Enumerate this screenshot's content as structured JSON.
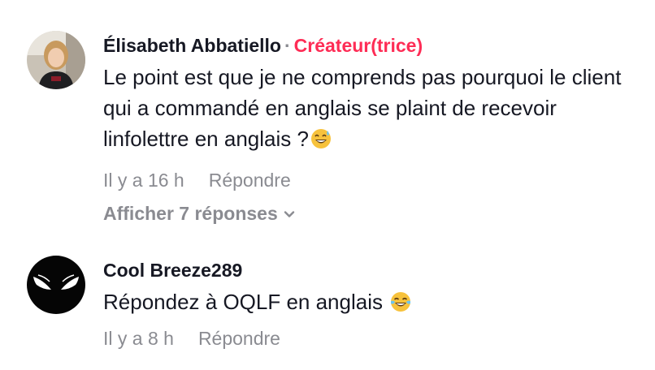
{
  "comments": [
    {
      "author": "Élisabeth Abbatiello",
      "separator": "·",
      "badge": "Créateur(trice)",
      "text": "Le point est que je ne comprends pas pourquoi le client qui a commandé en anglais se plaint de recevoir linfolettre en anglais ?",
      "emoji": "grinning-sweat-emoji",
      "time": "Il y a 16 h",
      "reply_label": "Répondre",
      "view_replies": "Afficher 7 réponses"
    },
    {
      "author": "Cool Breeze289",
      "text": "Répondez à OQLF en anglais",
      "emoji": "tears-of-joy-emoji",
      "time": "Il y a 8 h",
      "reply_label": "Répondre"
    }
  ],
  "colors": {
    "creator_badge": "#fe2c55",
    "secondary_text": "#8a8b91",
    "primary_text": "#161823"
  }
}
